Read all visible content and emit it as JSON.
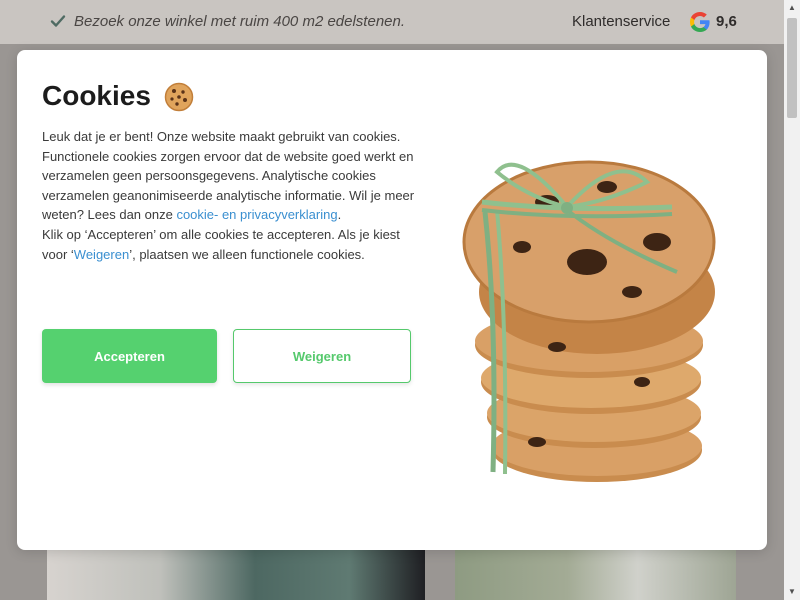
{
  "topbar": {
    "promo_text": "Bezoek onze winkel met ruim 400 m2 edelstenen.",
    "service_label": "Klantenservice",
    "google_rating": "9,6",
    "check_icon": "check-icon",
    "google_icon": "google-logo-icon"
  },
  "cookie_modal": {
    "title": "Cookies",
    "title_icon": "cookie-icon",
    "text_part1": "Leuk dat je er bent! Onze website maakt gebruikt van cookies. Functionele cookies zorgen ervoor dat de website goed werkt en verzamelen geen persoonsgegevens. Analytische cookies verzamelen geanonimiseerde analytische informatie. Wil je meer weten? Lees dan onze ",
    "privacy_link": "cookie- en privacyverklaring",
    "text_part2": ".",
    "text_part3": "Klik op ‘Accepteren’ om alle cookies te accepteren. Als je kiest voor ‘",
    "decline_link": "Weigeren",
    "text_part4": "’, plaatsen we alleen functionele cookies.",
    "accept_label": "Accepteren",
    "decline_label": "Weigeren",
    "image": "cookie-stack-image"
  },
  "colors": {
    "accent_green": "#55d16f",
    "link_blue": "#3a8fd0",
    "overlay": "#9a9693"
  }
}
